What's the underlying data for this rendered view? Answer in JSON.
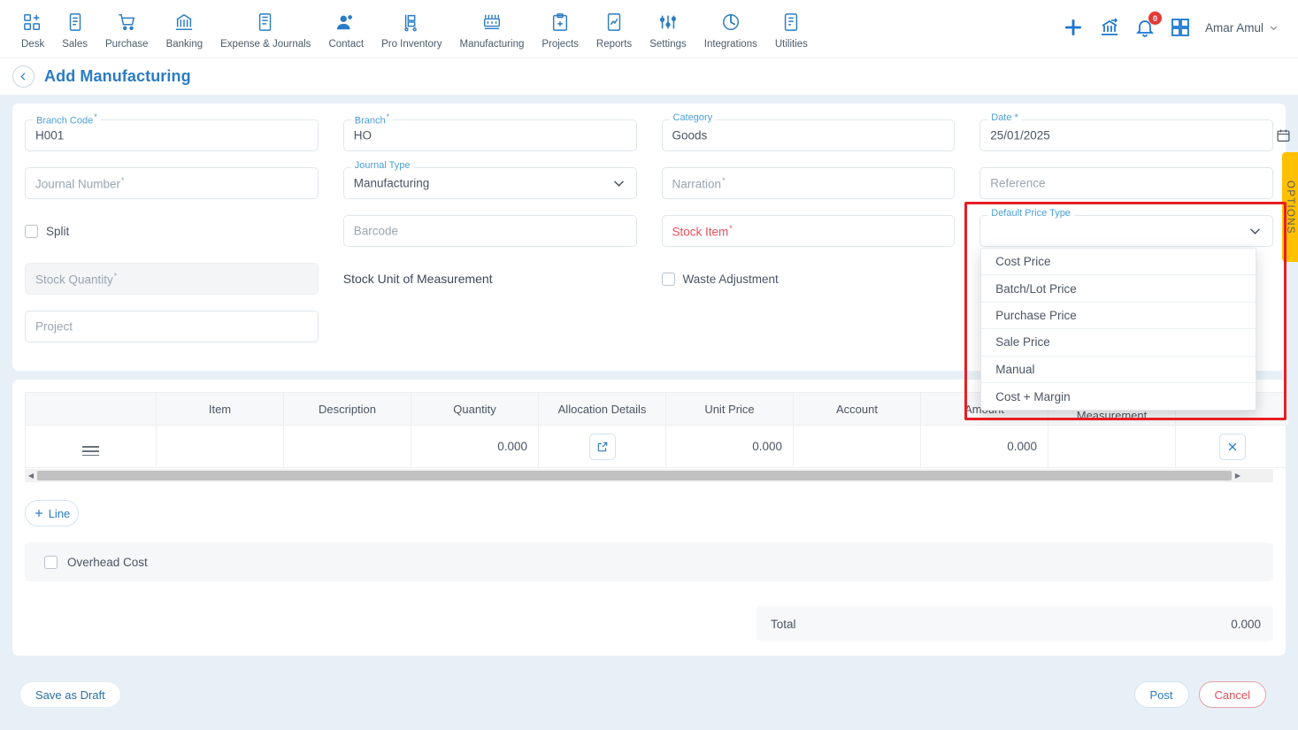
{
  "nav": {
    "items": [
      {
        "label": "Desk",
        "icon": "desk-icon"
      },
      {
        "label": "Sales",
        "icon": "sales-icon"
      },
      {
        "label": "Purchase",
        "icon": "purchase-cart-icon"
      },
      {
        "label": "Banking",
        "icon": "bank-icon"
      },
      {
        "label": "Expense & Journals",
        "icon": "journal-icon"
      },
      {
        "label": "Contact",
        "icon": "contact-icon"
      },
      {
        "label": "Pro Inventory",
        "icon": "inventory-icon"
      },
      {
        "label": "Manufacturing",
        "icon": "manufacturing-icon"
      },
      {
        "label": "Projects",
        "icon": "projects-icon"
      },
      {
        "label": "Reports",
        "icon": "reports-icon"
      },
      {
        "label": "Settings",
        "icon": "settings-sliders-icon"
      },
      {
        "label": "Integrations",
        "icon": "integrations-icon"
      },
      {
        "label": "Utilities",
        "icon": "utilities-icon"
      }
    ],
    "notification_count": "0",
    "user": "Amar Amul"
  },
  "header": {
    "title": "Add Manufacturing"
  },
  "form": {
    "branch_code": {
      "label": "Branch Code",
      "value": "H001"
    },
    "journal_number": {
      "placeholder": "Journal Number"
    },
    "split": {
      "label": "Split"
    },
    "stock_quantity": {
      "placeholder": "Stock Quantity"
    },
    "project": {
      "placeholder": "Project"
    },
    "branch": {
      "label": "Branch",
      "value": "HO"
    },
    "journal_type": {
      "label": "Journal Type",
      "value": "Manufacturing"
    },
    "barcode": {
      "placeholder": "Barcode"
    },
    "stock_uom_label": "Stock Unit of Measurement",
    "category": {
      "label": "Category",
      "value": "Goods"
    },
    "narration": {
      "placeholder": "Narration"
    },
    "stock_item": {
      "placeholder": "Stock Item"
    },
    "waste_adjustment": {
      "label": "Waste Adjustment"
    },
    "date": {
      "label": "Date *",
      "value": "25/01/2025"
    },
    "reference": {
      "placeholder": "Reference"
    },
    "default_price_type": {
      "label": "Default Price Type",
      "value": "",
      "options": [
        "Cost Price",
        "Batch/Lot Price",
        "Purchase Price",
        "Sale Price",
        "Manual",
        "Cost + Margin"
      ]
    }
  },
  "options_tab": {
    "label": "OPTIONS"
  },
  "table": {
    "columns": [
      "",
      "Item",
      "Description",
      "Quantity",
      "Allocation Details",
      "Unit Price",
      "Account",
      "Amount",
      "Unit of Measurement",
      ""
    ],
    "rows": [
      {
        "quantity": "0.000",
        "unit_price": "0.000",
        "amount": "0.000"
      }
    ]
  },
  "actions": {
    "add_line": "Line",
    "overhead_cost": "Overhead Cost",
    "total_label": "Total",
    "total_value": "0.000",
    "save_draft": "Save as Draft",
    "post": "Post",
    "cancel": "Cancel"
  },
  "colors": {
    "accent": "#2b7cc4",
    "danger": "#e8505b",
    "highlight": "#e81e25",
    "options_tab": "#ffc000",
    "page_bg": "#e8f0f7"
  }
}
